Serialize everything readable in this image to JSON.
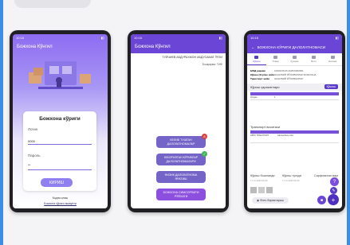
{
  "colors": {
    "accent": "#6b46d6",
    "red": "#d94040",
    "green": "#45b55a",
    "frame": "#3a8ee8"
  },
  "status": {
    "time": "10:16"
  },
  "login": {
    "appbar_title": "Божхона Кўнгил",
    "card_title": "Божхона кўриги",
    "login_label": "Логин",
    "login_value": "0000",
    "password_label": "Пароль",
    "password_value": "**",
    "submit": "КИРИШ",
    "footer_button": "Кодни олиш",
    "footer_link": "Божхона кўриги аккаунти"
  },
  "menu": {
    "appbar_title": "Божхона Кўнгил",
    "header_line": "ТУЙЧИЕВ АБДУРАХМОН АБДУСАМАТ ЎҒЛИ",
    "sub_line": "Бошқарма: ТИФ",
    "buttons": [
      {
        "label": "КЕЛИБ ТУШГАН\nДАЛОЛАТНОМАЛАР",
        "badge": "8",
        "badge_color": "#d94040"
      },
      {
        "label": "ЮБОРИЛГАН КЎРИКЛАР\nДАЛОЛАТНОМАЛАРИ",
        "badge": "✓",
        "badge_color": "#45b55a"
      },
      {
        "label": "ФИЗИК ДАЛОЛАТНОМА\nЯРАТИШ",
        "badge": "",
        "badge_color": ""
      },
      {
        "label": "БОЖХОНА СИМСОРЛАРИ\nРЎЙХАТИ",
        "badge": "",
        "badge_color": ""
      }
    ]
  },
  "detail": {
    "appbar_title": "БОЖХОНА КЎРИГИ ДАЛОЛАТНОМАСИ",
    "tabs": [
      "Кўриш",
      "Товар",
      "Ҳужжат",
      "Фото",
      "Натижа"
    ],
    "fields": [
      {
        "k": "БЮД рақами",
        "v": "10002/06.06.2025/0000001"
      },
      {
        "k": "Кўриш (Усулик лойи",
        "v": "ЖАНУБИЙ ЙЎЛОВЧИЛАР БОЖХОНА"
      },
      {
        "k": "Транспорт жойи",
        "v": "ЖАНУБИЙ ЙЎЛОВЧИЛАР"
      }
    ],
    "section1_title": "Кўриш ҳаракатлари",
    "section1_button": "Қўшиш",
    "grid1_head": [
      "Ҳаракатлар",
      "№ т/т",
      "Объект"
    ],
    "grid1_row": [
      "Кўздан...",
      "1",
      ""
    ],
    "section2_title": "Транспорт воситаси",
    "grid2_head": [
      "№",
      "Транспорт тури",
      "Транспорт рақами",
      "Изоҳ"
    ],
    "grid2_row": [
      "АВТО ТРАНСПОРТ",
      "",
      "Автомобиль 01А",
      ""
    ],
    "bottom_labels": [
      "Кўриш бошланди",
      "Кўриш тугади",
      "Сарфланган вақт"
    ],
    "bottom_values": [
      "17.11.2025 09:30",
      "17.11.2025 09:40",
      ""
    ],
    "photo_label": "Фото бириктириш",
    "fab_question": "?",
    "fab_add": "+"
  }
}
